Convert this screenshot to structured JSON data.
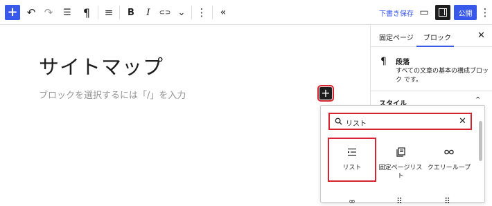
{
  "toolbar": {
    "add_label": "+",
    "undo_icon": "↶",
    "redo_icon": "↷",
    "list_view_icon": "☰",
    "paragraph_icon": "¶",
    "align_icon": "≡",
    "bold_label": "B",
    "italic_label": "I",
    "link_icon": "⊂⊃",
    "more_chevron": "⌄",
    "options_icon": "⋮",
    "collapse_icon": "«",
    "draft_save": "下書き保存",
    "preview_icon": "▭",
    "publish": "公開",
    "more_menu_icon": "⋮"
  },
  "editor": {
    "title": "サイトマップ",
    "placeholder": "ブロックを選択するには「/」を入力",
    "inserter_plus": "+"
  },
  "sidebar": {
    "tabs": [
      "固定ページ",
      "ブロック"
    ],
    "active_tab": "ブロック",
    "close": "✕",
    "block_icon": "¶",
    "block_title": "段落",
    "block_desc": "すべての文章の基本の構成ブロック です。",
    "style_label": "スタイル",
    "style_chevron": "⌃"
  },
  "inserter": {
    "search_value": "リスト",
    "clear_icon": "✕",
    "results": [
      {
        "label": "リスト",
        "icon": "list-icon"
      },
      {
        "label": "固定ページリスト",
        "icon": "page-list-icon"
      },
      {
        "label": "クエリーループ",
        "icon": "loop-icon"
      }
    ]
  },
  "colors": {
    "accent": "#3858e9",
    "highlight": "#d6232f"
  }
}
